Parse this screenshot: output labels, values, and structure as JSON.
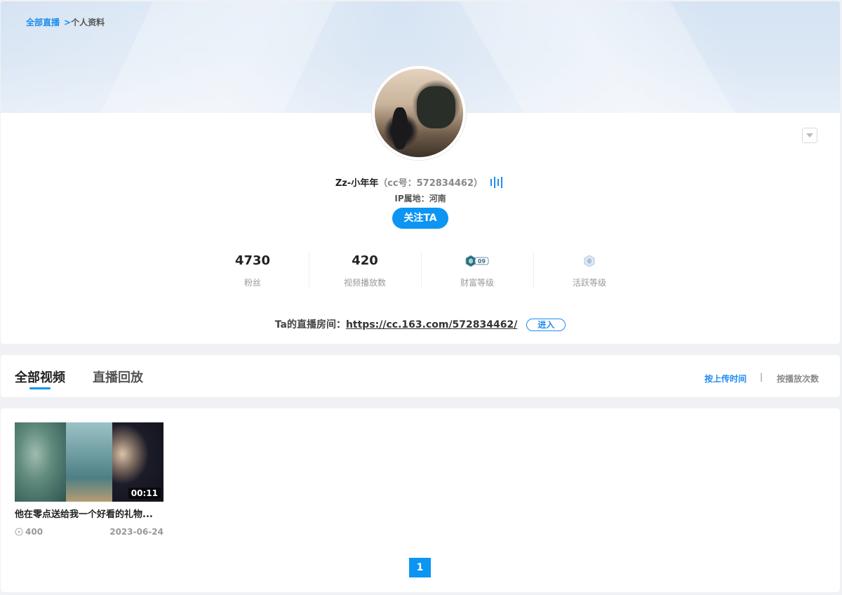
{
  "breadcrumb": {
    "home": "全部直播",
    "separator": ">",
    "current": "个人资料"
  },
  "profile": {
    "nickname": "Zz-小年年",
    "cc_id_text": "（cc号：572834462）",
    "ip_location": "IP属地：河南",
    "follow_label": "关注TA",
    "live_icon": "live-signal-icon"
  },
  "stats": [
    {
      "value": "4730",
      "label": "粉丝"
    },
    {
      "value": "420",
      "label": "视频播放数"
    },
    {
      "badge": "09",
      "label": "财富等级"
    },
    {
      "label": "活跃等级"
    }
  ],
  "room": {
    "prefix": "Ta的直播房间：",
    "url": "https://cc.163.com/572834462/",
    "enter_label": "进入"
  },
  "tabs": [
    {
      "label": "全部视频",
      "active": true
    },
    {
      "label": "直播回放",
      "active": false
    }
  ],
  "sort": {
    "by_time": "按上传时间",
    "divider": "|",
    "by_plays": "按播放次数"
  },
  "videos": [
    {
      "duration": "00:11",
      "title": "他在零点送给我一个好看的礼物...",
      "plays": "400",
      "date": "2023-06-24"
    }
  ],
  "pagination": {
    "current": "1"
  },
  "colors": {
    "accent": "#0c95f2",
    "link": "#1e8cf0"
  }
}
